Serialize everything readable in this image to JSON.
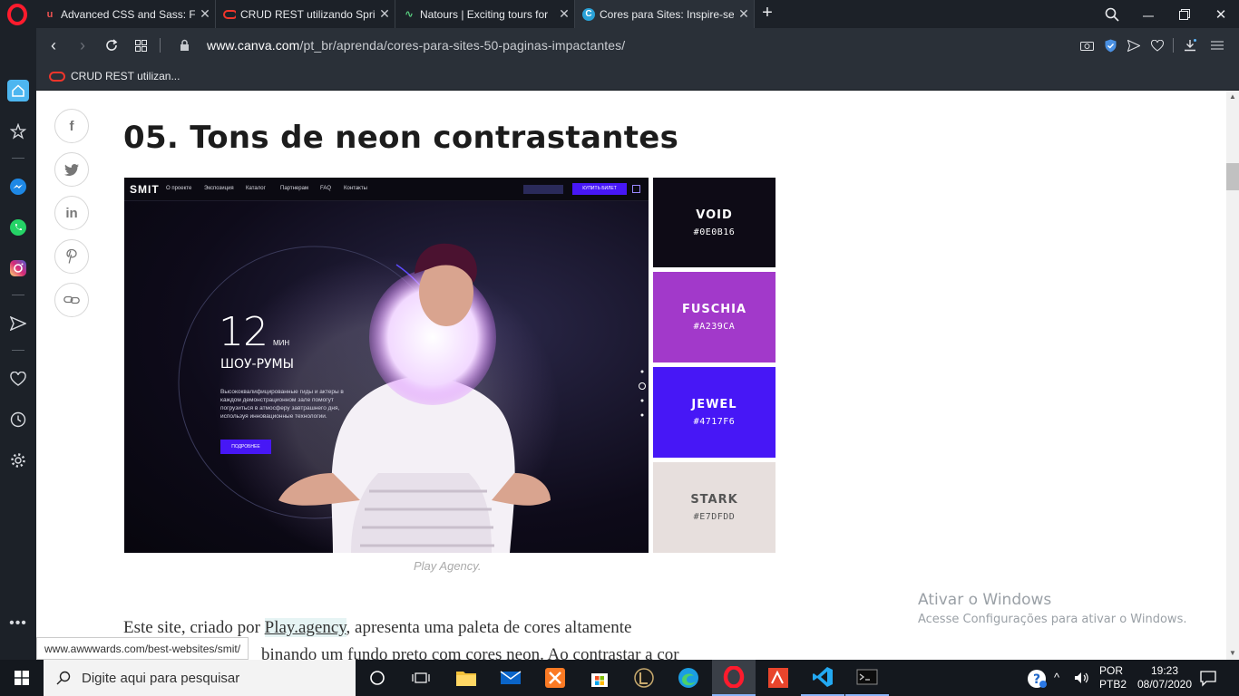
{
  "browser": {
    "tabs": [
      {
        "title": "Advanced CSS and Sass: Fle",
        "favicon": "udemy",
        "active": false
      },
      {
        "title": "CRUD REST utilizando Sprin",
        "favicon": "oracle",
        "active": false
      },
      {
        "title": "Natours | Exciting tours for",
        "favicon": "natours",
        "active": false
      },
      {
        "title": "Cores para Sites: Inspire-se",
        "favicon": "canva",
        "active": true
      }
    ],
    "url_domain": "www.canva.com",
    "url_path": "/pt_br/aprenda/cores-para-sites-50-paginas-impactantes/",
    "bookmarks": [
      {
        "label": "CRUD REST utilizan..."
      }
    ]
  },
  "article": {
    "heading": "05. Tons de neon contrastantes",
    "hero": {
      "logo": "SMIT",
      "nav": [
        "О проекте",
        "Экспозиция",
        "Каталог",
        "Партнерам",
        "FAQ",
        "Контакты"
      ],
      "cta": "КУПИТЬ БИЛЕТ",
      "big_number": "12",
      "unit": "МИН",
      "subtitle": "ШОУ-РУМЫ",
      "body": "Высококвалифицированные гиды и актеры в каждом демонстрационном зале помогут погрузиться в атмосферу завтрашнего дня, используя инновационные технологии.",
      "button": "ПОДРОБНЕЕ"
    },
    "swatches": [
      {
        "name": "VOID",
        "hex": "#0E0B16",
        "color": "#0e0b16",
        "text": "#ffffff"
      },
      {
        "name": "FUSCHIA",
        "hex": "#A239CA",
        "color": "#a239ca",
        "text": "#ffffff"
      },
      {
        "name": "JEWEL",
        "hex": "#4717F6",
        "color": "#4717f6",
        "text": "#ffffff"
      },
      {
        "name": "STARK",
        "hex": "#E7DFDD",
        "color": "#e7dfdd",
        "text": "#555555"
      }
    ],
    "caption": "Play Agency.",
    "para_before": "Este site, criado por ",
    "para_link": "Play.agency",
    "para_after": ", apresenta uma paleta de cores altamente",
    "para_line2": "binando um fundo preto com cores neon. Ao contrastar a cor"
  },
  "activation": {
    "title": "Ativar o Windows",
    "subtitle": "Acesse Configurações para ativar o Windows."
  },
  "status_url": "www.awwwards.com/best-websites/smit/",
  "taskbar": {
    "search_placeholder": "Digite aqui para pesquisar",
    "lang1": "POR",
    "lang2": "PTB2",
    "time": "19:23",
    "date": "08/07/2020"
  }
}
